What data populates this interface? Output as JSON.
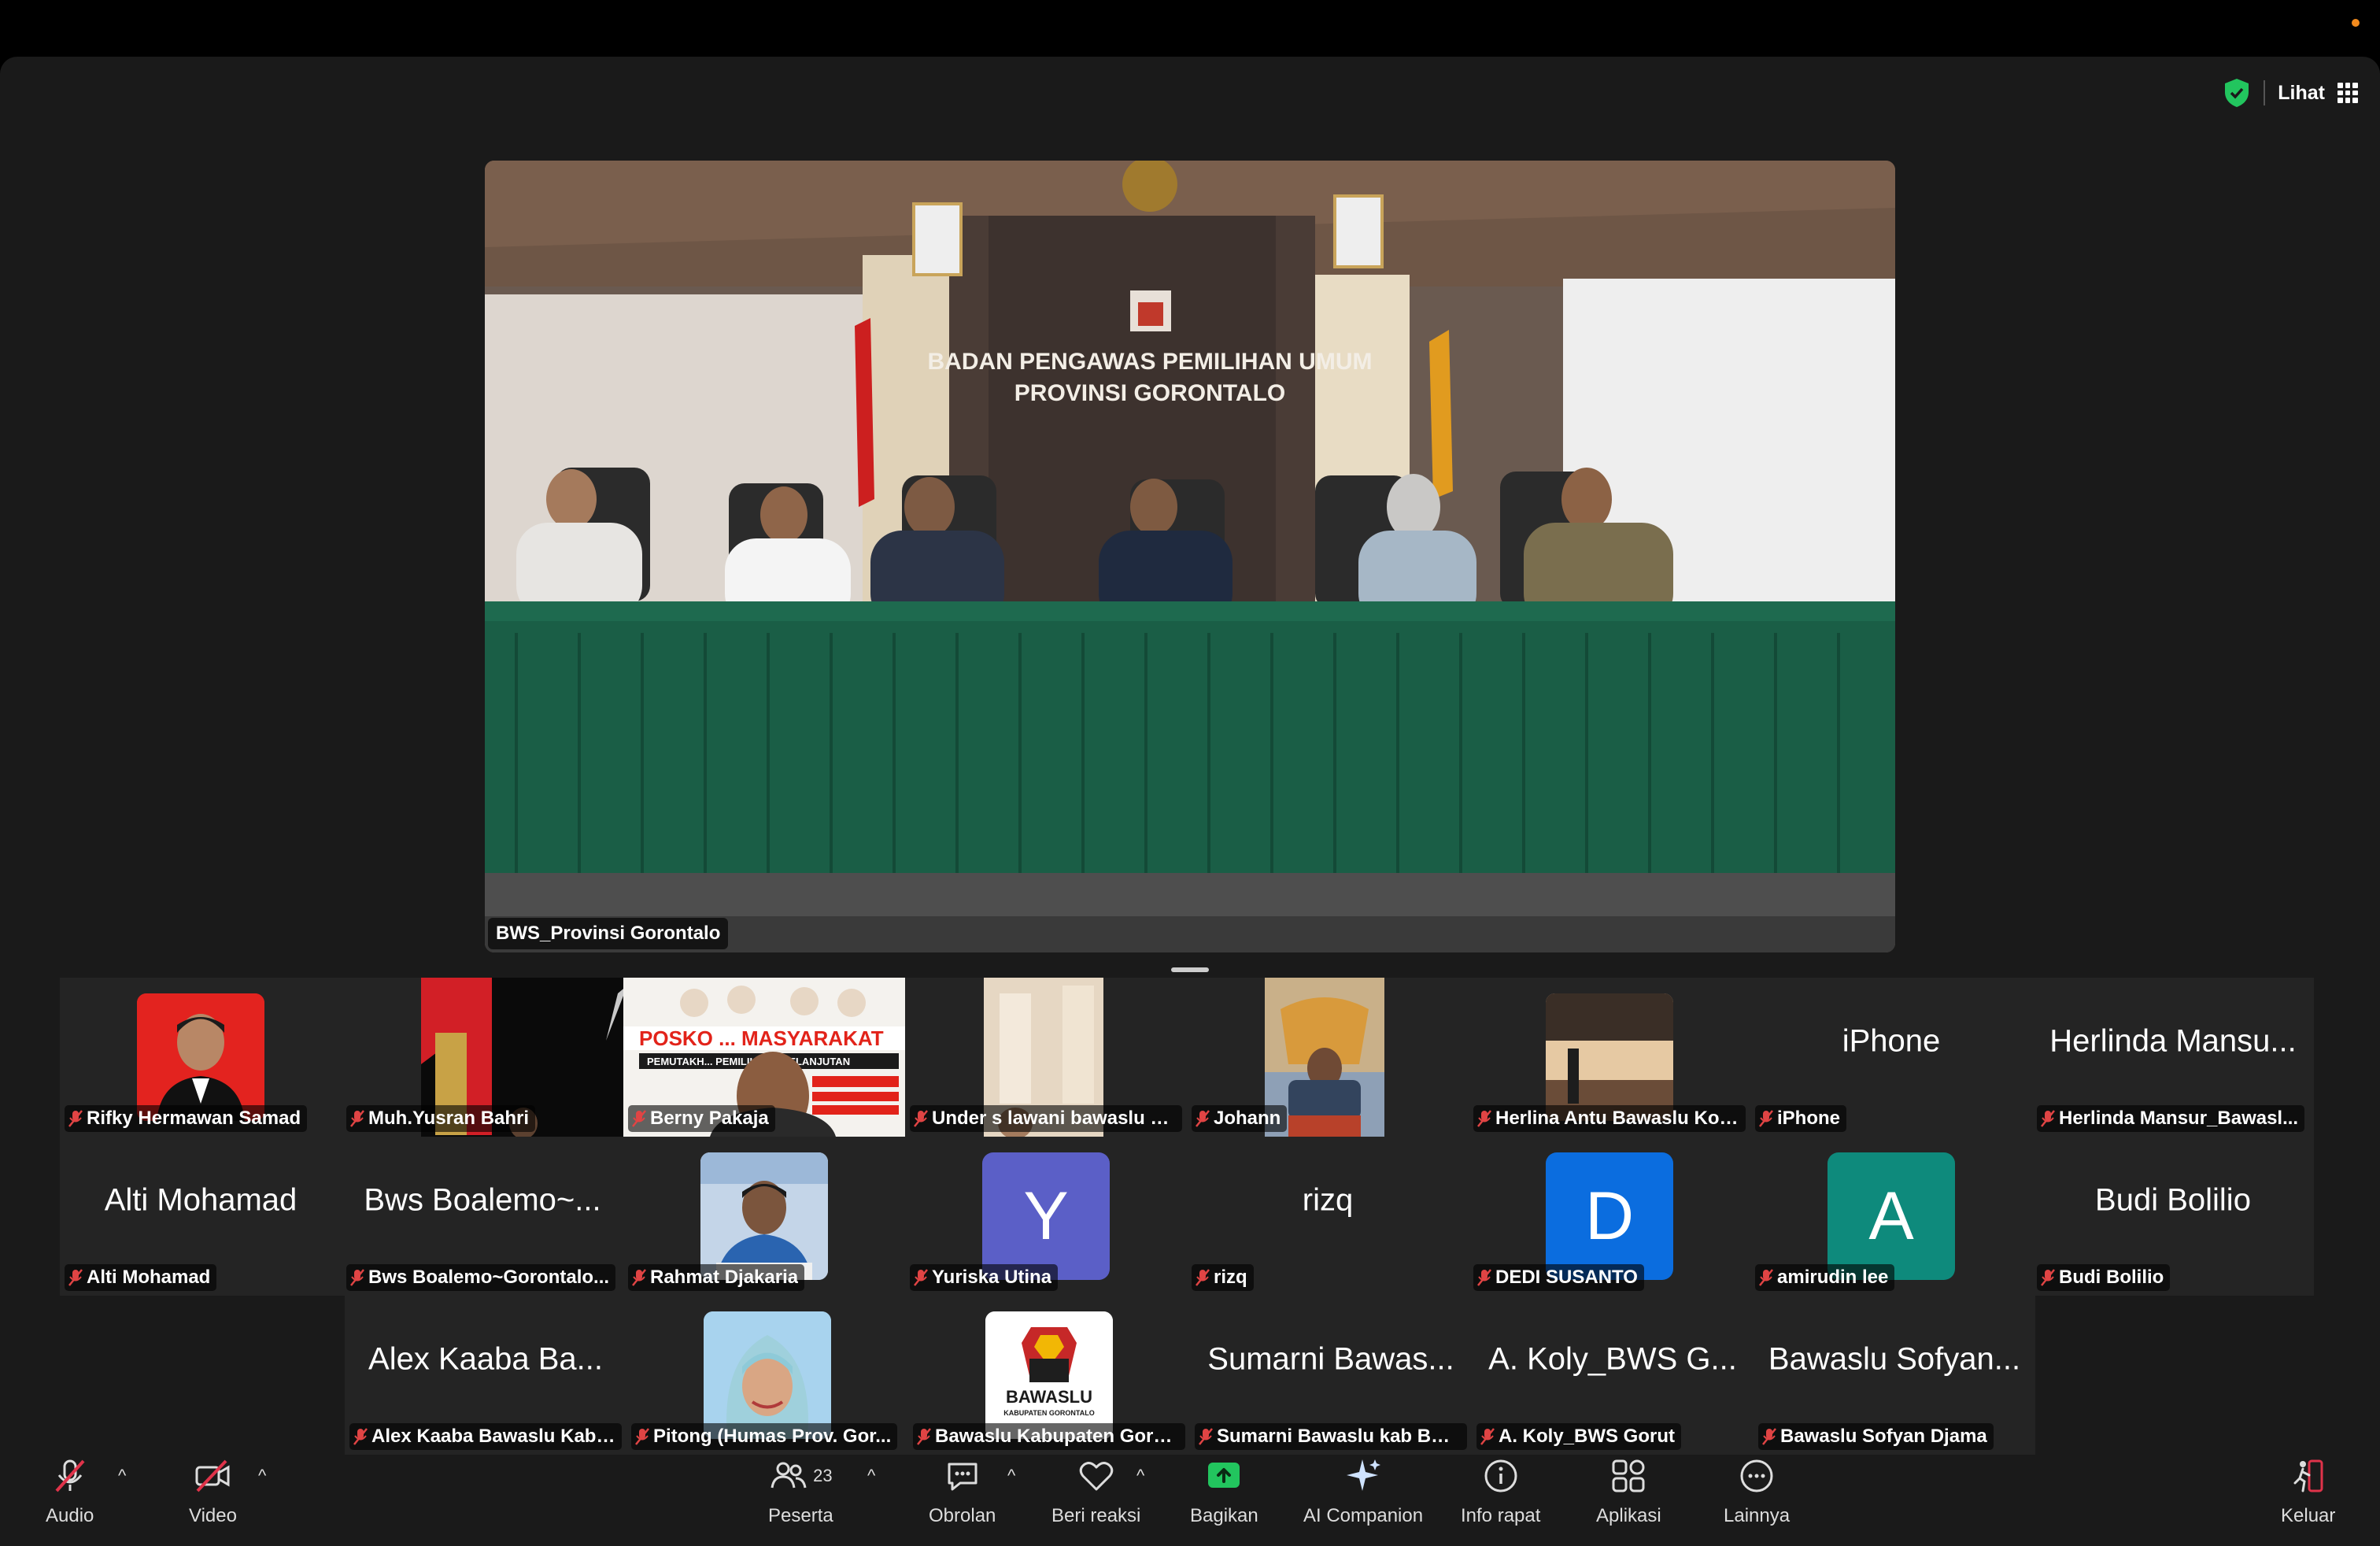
{
  "header": {
    "view_label": "Lihat"
  },
  "speaker": {
    "name": "BWS_Provinsi Gorontalo",
    "sign_line1": "BADAN PENGAWAS PEMILIHAN UMUM",
    "sign_line2": "PROVINSI GORONTALO"
  },
  "gallery": {
    "row1": [
      {
        "label": "Rifky Hermawan Samad"
      },
      {
        "label": "Muh.Yusran Bahri"
      },
      {
        "label": "Berny Pakaja",
        "poster_title": "POSKO ... MASYARAKAT",
        "poster_sub": "PEMUTAKH... PEMILIH BERKELANJUTAN"
      },
      {
        "label": "Under s lawani bawaslu k..."
      },
      {
        "label": "Johann"
      },
      {
        "label": "Herlina Antu Bawaslu Kot..."
      },
      {
        "label": "iPhone",
        "display": "iPhone"
      },
      {
        "label": "Herlinda Mansur_Bawasl...",
        "display": "Herlinda Mansu..."
      }
    ],
    "row2": [
      {
        "label": "Alti Mohamad",
        "display": "Alti Mohamad"
      },
      {
        "label": "Bws Boalemo~Gorontalo...",
        "display": "Bws Boalemo~..."
      },
      {
        "label": "Rahmat Djakaria"
      },
      {
        "label": "Yuriska Utina",
        "letter": "Y"
      },
      {
        "label": "rizq",
        "display": "rizq"
      },
      {
        "label": "DEDI SUSANTO",
        "letter": "D"
      },
      {
        "label": "amirudin lee",
        "letter": "A"
      },
      {
        "label": "Budi Bolilio",
        "display": "Budi Bolilio"
      }
    ],
    "row3": [
      {
        "label": "Alex Kaaba Bawaslu Kab....",
        "display": "Alex Kaaba Ba..."
      },
      {
        "label": "Pitong (Humas Prov. Gor..."
      },
      {
        "label": "Bawaslu Kabupaten Goro...",
        "logo_text": "BAWASLU",
        "logo_sub": "KABUPATEN GORONTALO"
      },
      {
        "label": "Sumarni Bawaslu kab Boa...",
        "display": "Sumarni Bawas..."
      },
      {
        "label": "A. Koly_BWS Gorut",
        "display": "A. Koly_BWS G..."
      },
      {
        "label": "Bawaslu Sofyan Djama",
        "display": "Bawaslu Sofyan..."
      }
    ]
  },
  "toolbar": {
    "audio": "Audio",
    "video": "Video",
    "participants": "Peserta",
    "participants_count": "23",
    "chat": "Obrolan",
    "react": "Beri reaksi",
    "share": "Bagikan",
    "ai": "AI Companion",
    "info": "Info rapat",
    "apps": "Aplikasi",
    "more": "Lainnya",
    "leave": "Keluar"
  },
  "colors": {
    "yuriska": "#5b5fc7",
    "dedi": "#0b6ddf",
    "amirudin": "#0e8a7c",
    "share_green": "#22c55e",
    "shield_green": "#22c55e"
  }
}
